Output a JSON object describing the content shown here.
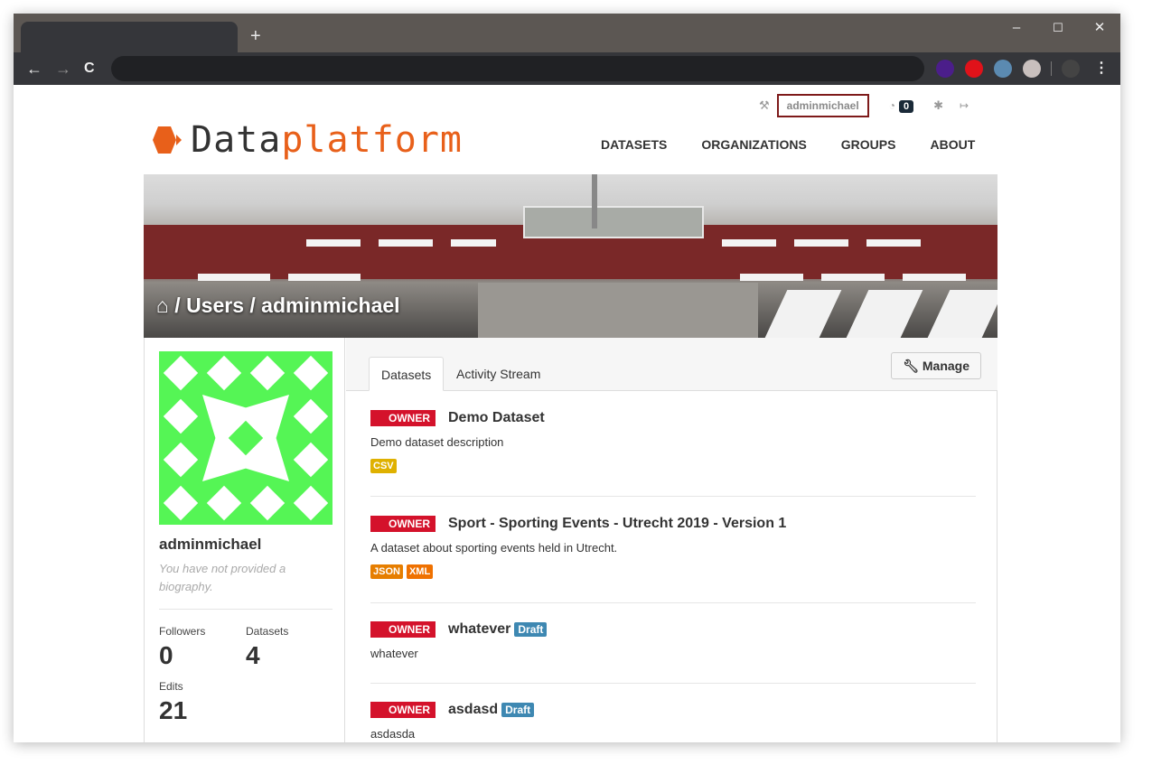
{
  "browser": {
    "new_tab_label": "+",
    "window_controls": [
      "–",
      "☐",
      "✕"
    ],
    "extension_colors": [
      "#4b1e8a",
      "#e0121a",
      "#5b8ab1",
      "#c8bfbd",
      "#444444"
    ]
  },
  "account": {
    "username": "adminmichael",
    "dashboard_count": "0"
  },
  "brand": {
    "logo_part1": "Data",
    "logo_part2": "platform",
    "accent": "#e8601a"
  },
  "nav": {
    "items": [
      "DATASETS",
      "ORGANIZATIONS",
      "GROUPS",
      "ABOUT"
    ]
  },
  "breadcrumb": "/ Users / adminmichael",
  "profile": {
    "username": "adminmichael",
    "bio": "You have not provided a biography.",
    "followers_label": "Followers",
    "followers": "0",
    "datasets_label": "Datasets",
    "datasets": "4",
    "edits_label": "Edits",
    "edits": "21"
  },
  "tabs": {
    "datasets": "Datasets",
    "activity": "Activity Stream",
    "manage": "Manage"
  },
  "datasets": [
    {
      "badge": "OWNER",
      "title": "Demo Dataset",
      "draft": "",
      "description": "Demo dataset description",
      "formats": [
        "CSV"
      ]
    },
    {
      "badge": "OWNER",
      "title": "Sport - Sporting Events - Utrecht 2019 - Version 1",
      "draft": "",
      "description": "A dataset about sporting events held in Utrecht.",
      "formats": [
        "JSON",
        "XML"
      ]
    },
    {
      "badge": "OWNER",
      "title": "whatever",
      "draft": "Draft",
      "description": "whatever",
      "formats": []
    },
    {
      "badge": "OWNER",
      "title": "asdasd",
      "draft": "Draft",
      "description": "asdasda",
      "formats": []
    }
  ],
  "format_colors": {
    "CSV": "#dfb100",
    "JSON": "#e67e00",
    "XML": "#ef7100"
  }
}
